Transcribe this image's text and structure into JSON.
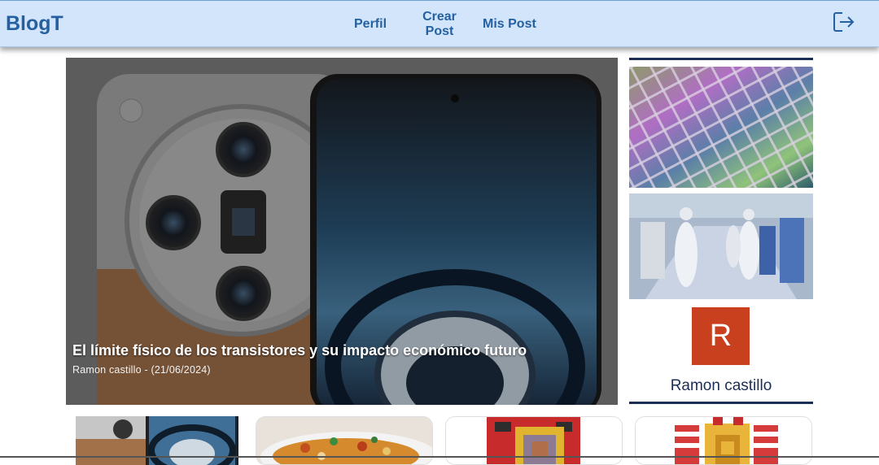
{
  "header": {
    "brand": "BlogT",
    "nav": [
      {
        "label": "Perfil"
      },
      {
        "label": "Crear Post"
      },
      {
        "label": "Mis Post"
      }
    ],
    "logout_icon": "logout-icon"
  },
  "hero": {
    "title": "El límite físico de los transistores y su impacto económico futuro",
    "meta": "Ramon castillo - (21/06/2024)"
  },
  "sidebar": {
    "avatar_letter": "R",
    "author": "Ramon castillo",
    "accent": "#1b2e55",
    "avatar_color": "#c8401e"
  },
  "colors": {
    "header_bg": "#d3e5fb",
    "brand": "#2561a0"
  }
}
